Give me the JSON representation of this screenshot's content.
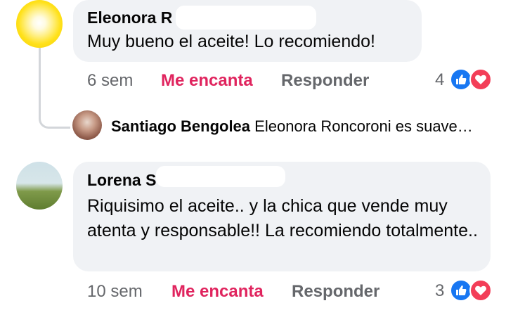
{
  "comments": [
    {
      "author": "Eleonora R",
      "text": "Muy bueno el aceite! Lo recomiendo!",
      "time": "6 sem",
      "reaction_label": "Me encanta",
      "reply_label": "Responder",
      "reaction_count": "4",
      "reaction_icons": [
        "like-icon",
        "love-icon"
      ]
    },
    {
      "author": "Lorena S",
      "text": "Riquisimo el aceite.. y la chica que vende muy atenta y responsable!! La recomiendo totalmente..",
      "time": "10 sem",
      "reaction_label": "Me encanta",
      "reply_label": "Responder",
      "reaction_count": "3",
      "reaction_icons": [
        "like-icon",
        "love-icon"
      ]
    }
  ],
  "reply_preview": {
    "author": "Santiago Bengolea",
    "text": "Eleonora Roncoroni es suave…"
  },
  "colors": {
    "bubble": "#f0f2f5",
    "reaction_active": "#e0245e",
    "meta_text": "#65676b",
    "like_blue": "#1877f2",
    "love_red": "#f33e58"
  }
}
